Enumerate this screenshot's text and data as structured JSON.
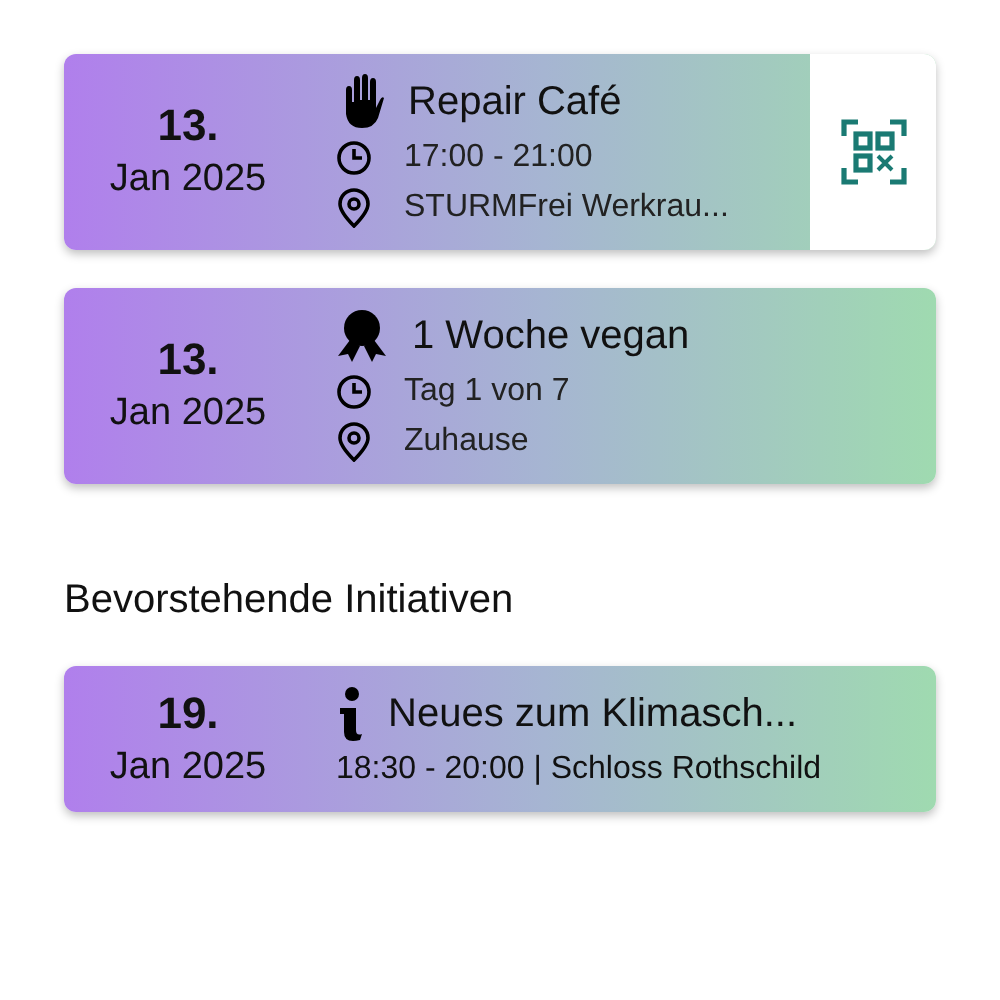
{
  "sections": [
    {
      "cards": [
        {
          "kind": "workshop",
          "day": "13.",
          "month": "Jan 2025",
          "title": "Repair Café",
          "lines": [
            {
              "kind": "time",
              "text": "17:00 - 21:00"
            },
            {
              "kind": "place",
              "text": "STURMFrei Werkrau..."
            }
          ]
        },
        {
          "kind": "challenge",
          "day": "13.",
          "month": "Jan 2025",
          "title": "1 Woche vegan",
          "lines": [
            {
              "kind": "time",
              "text": "Tag 1 von 7"
            },
            {
              "kind": "place",
              "text": "Zuhause"
            }
          ]
        }
      ]
    },
    {
      "heading": "Bevorstehende Initiativen",
      "cards": [
        {
          "kind": "talk",
          "day": "19.",
          "month": "Jan 2025",
          "title": "Neues zum Klimasch...",
          "lines": [
            {
              "kind": "summary",
              "text": "18:30 - 20:00 | Schloss Rothschild"
            }
          ]
        }
      ]
    }
  ]
}
